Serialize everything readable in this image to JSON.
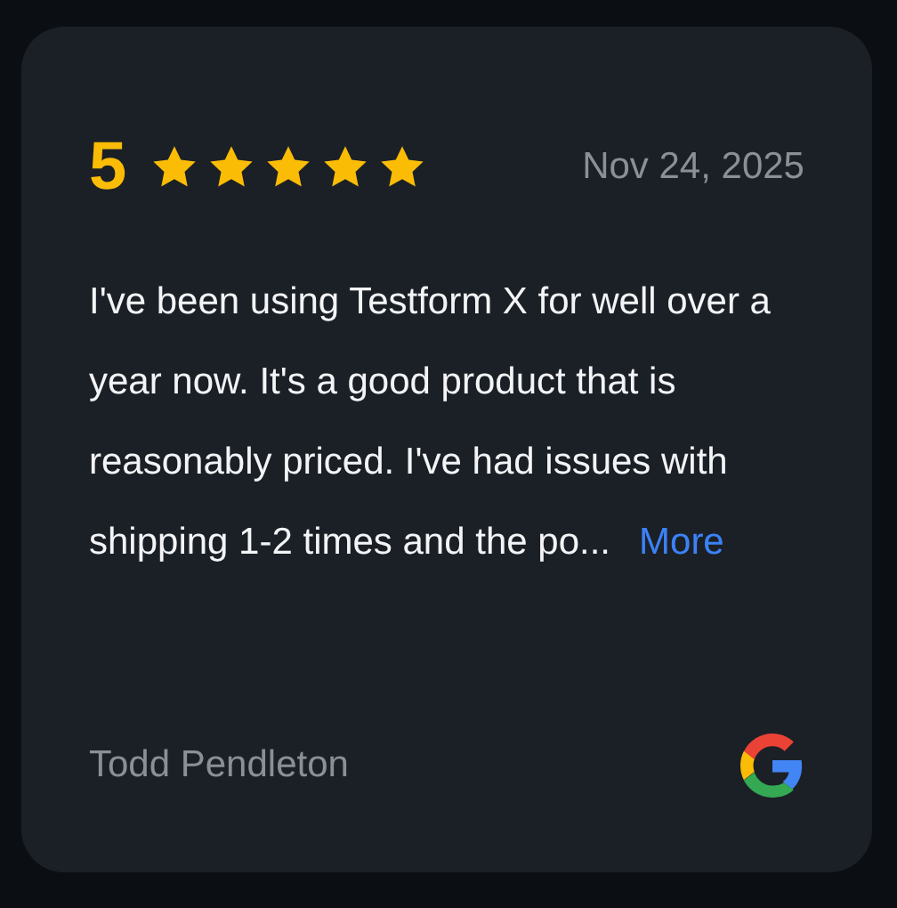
{
  "review": {
    "rating": "5",
    "stars": 5,
    "date": "Nov 24, 2025",
    "text": "I've been using Testform X for well over a year now. It's a good product that is reasonably priced. I've had issues with shipping 1-2 times and the po...",
    "more": "More",
    "author": "Todd Pendleton"
  }
}
